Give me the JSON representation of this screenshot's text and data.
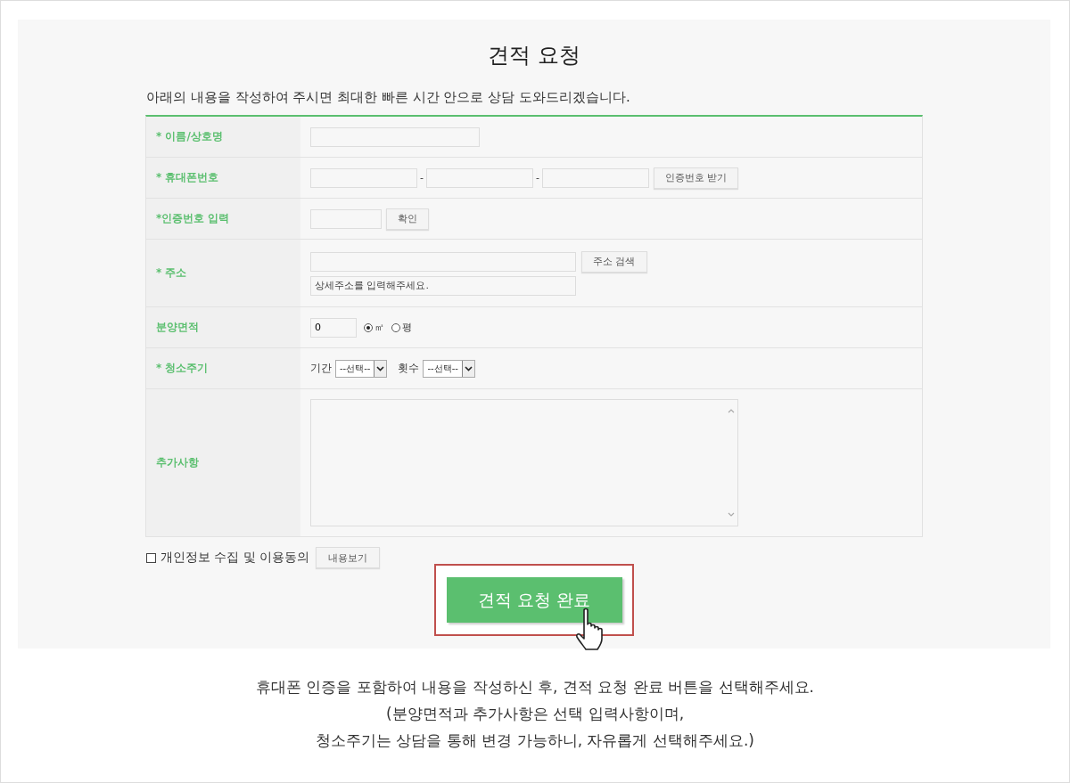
{
  "title": "견적 요청",
  "intro": "아래의 내용을 작성하여 주시면 최대한 빠른 시간 안으로 상담 도와드리겠습니다.",
  "fields": [
    {
      "kind": "text",
      "label": "* 이름/상호명"
    },
    {
      "kind": "phone",
      "label": "* 휴대폰번호",
      "separators": [
        "-",
        "-"
      ],
      "button": "인증번호 받기"
    },
    {
      "kind": "verify",
      "label": "*인증번호 입력",
      "button": "확인"
    },
    {
      "kind": "address",
      "label": "* 주소",
      "button": "주소 검색",
      "placeholder": "상세주소를 입력해주세요."
    },
    {
      "kind": "area",
      "label": "분양면적",
      "value": "0",
      "units": [
        {
          "label": "㎡",
          "selected": true
        },
        {
          "label": "평",
          "selected": false
        }
      ]
    },
    {
      "kind": "cycle",
      "label": "* 청소주기",
      "selects": [
        {
          "label": "기간",
          "value": "--선택--"
        },
        {
          "label": "횟수",
          "value": "--선택--"
        }
      ]
    },
    {
      "kind": "textarea",
      "label": "추가사항"
    }
  ],
  "consent": {
    "checked": false,
    "label": "개인정보 수집 및 이용동의",
    "button": "내용보기"
  },
  "submit": "견적 요청 완료",
  "caption": [
    "휴대폰 인증을 포함하여 내용을 작성하신 후, 견적 요청 완료 버튼을 선택해주세요.",
    "(분양면적과 추가사항은 선택 입력사항이며,",
    "청소주기는 상담을 통해 변경 가능하니, 자유롭게 선택해주세요.)"
  ]
}
